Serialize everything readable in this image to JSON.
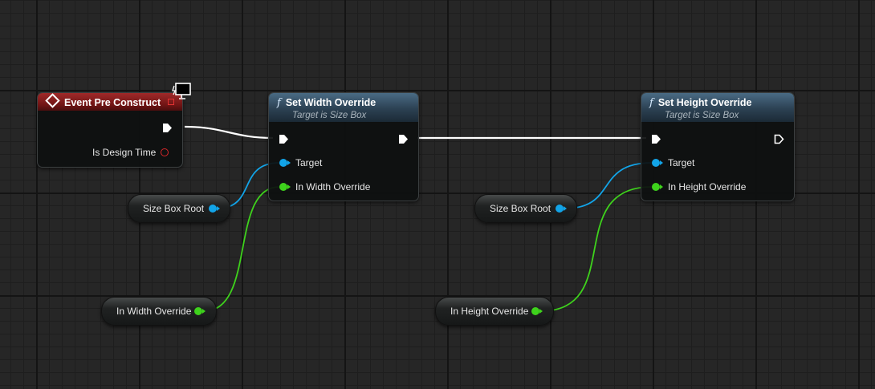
{
  "nodes": {
    "event_pre_construct": {
      "title": "Event Pre Construct",
      "pins": {
        "is_design_time": "Is Design Time"
      }
    },
    "set_width_override": {
      "title": "Set Width Override",
      "subtitle": "Target is Size Box",
      "pins": {
        "target": "Target",
        "value": "In Width Override"
      }
    },
    "set_height_override": {
      "title": "Set Height Override",
      "subtitle": "Target is Size Box",
      "pins": {
        "target": "Target",
        "value": "In Height Override"
      }
    }
  },
  "variables": {
    "size_box_root_1": "Size Box Root",
    "in_width_override": "In Width Override",
    "size_box_root_2": "Size Box Root",
    "in_height_override": "In Height Override"
  },
  "colors": {
    "object_pin": "#12a4e8",
    "float_pin": "#3ed21c",
    "event_header": "#8a1c1c",
    "function_header": "#3a5870",
    "exec_wire": "#ffffff"
  },
  "icons": {
    "event": "event-diamond-icon",
    "function": "function-f-icon",
    "editor_only": "monitor-icon"
  }
}
